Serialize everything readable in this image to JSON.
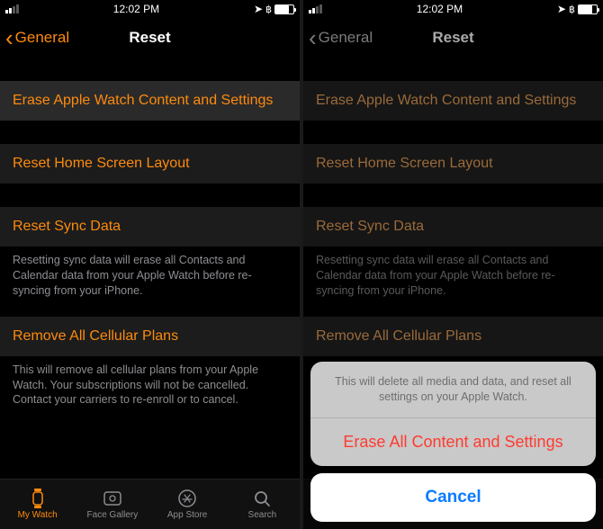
{
  "status": {
    "time": "12:02 PM"
  },
  "nav": {
    "back": "General",
    "title": "Reset"
  },
  "cells": {
    "erase": "Erase Apple Watch Content and Settings",
    "home_layout": "Reset Home Screen Layout",
    "sync_data": "Reset Sync Data",
    "sync_footer": "Resetting sync data will erase all Contacts and Calendar data from your Apple Watch before re-syncing from your iPhone.",
    "cellular": "Remove All Cellular Plans",
    "cellular_footer": "This will remove all cellular plans from your Apple Watch. Your subscriptions will not be cancelled. Contact your carriers to re-enroll or to cancel.",
    "cellular_footer_cut": "This will remove all cellular plans from your Apple Watch. Your subscriptions will not be cancelled. Contact your"
  },
  "tabs": {
    "my_watch": "My Watch",
    "face_gallery": "Face Gallery",
    "app_store": "App Store",
    "search": "Search"
  },
  "sheet": {
    "message": "This will delete all media and data, and reset all settings on your Apple Watch.",
    "action": "Erase All Content and Settings",
    "cancel": "Cancel"
  }
}
